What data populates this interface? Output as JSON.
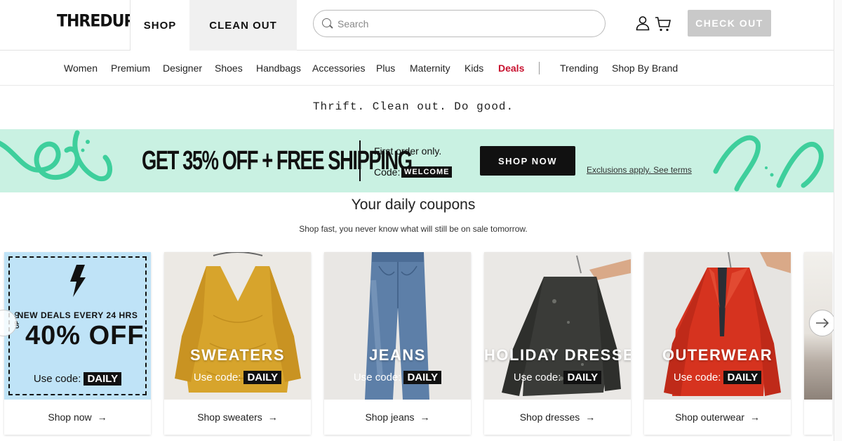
{
  "header": {
    "logo": "THREDUP",
    "tabs": [
      "SHOP",
      "CLEAN OUT"
    ],
    "search_placeholder": "Search",
    "checkout_label": "CHECK OUT",
    "icons": [
      "user-icon",
      "cart-icon",
      "search-icon"
    ]
  },
  "nav": {
    "items": [
      "Women",
      "Premium",
      "Designer",
      "Shoes",
      "Handbags",
      "Accessories",
      "Plus",
      "Maternity",
      "Kids",
      "Deals"
    ],
    "secondary": [
      "Trending",
      "Shop By Brand"
    ],
    "deals_color": "#c8102e"
  },
  "tagline": "Thrift. Clean out. Do good.",
  "banner": {
    "headline": "GET 35% OFF + FREE SHIPPING",
    "first_order": "First order only.",
    "code_label": "Code:",
    "code": "WELCOME",
    "cta": "SHOP NOW",
    "exclusions": "Exclusions apply. See terms",
    "bg_color": "#c9f1e2",
    "accent_color": "#3ecf9c"
  },
  "coupons": {
    "title": "Your daily coupons",
    "subtitle": "Shop fast, you never know what will still be on sale tomorrow.",
    "deal_card": {
      "line1": "NEW DEALS EVERY 24 HRS",
      "up_to": "UP TO",
      "percent": "40% OFF",
      "code_label": "Use code:",
      "code": "DAILY",
      "link": "Shop now"
    },
    "cards": [
      {
        "title": "SWEATERS",
        "code_label": "Use code:",
        "code": "DAILY",
        "link": "Shop sweaters"
      },
      {
        "title": "JEANS",
        "code_label": "Use code:",
        "code": "DAILY",
        "link": "Shop jeans"
      },
      {
        "title": "HOLIDAY DRESSES",
        "code_label": "Use code:",
        "code": "DAILY",
        "link": "Shop dresses"
      },
      {
        "title": "OUTERWEAR",
        "code_label": "Use code:",
        "code": "DAILY",
        "link": "Shop outerwear"
      }
    ]
  }
}
